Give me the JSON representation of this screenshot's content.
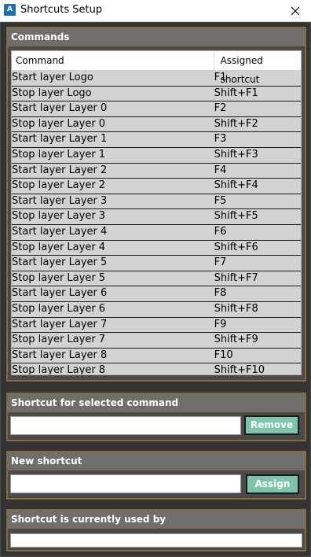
{
  "window": {
    "title": "Shortcuts Setup",
    "app_icon_text": "A"
  },
  "commands": {
    "header": "Commands",
    "columns": [
      "Command",
      "Assigned shortcut"
    ],
    "rows": [
      [
        "Start layer Logo",
        "F1"
      ],
      [
        "Stop layer Logo",
        "Shift+F1"
      ],
      [
        "Start layer Layer 0",
        "F2"
      ],
      [
        "Stop layer Layer 0",
        "Shift+F2"
      ],
      [
        "Start layer Layer 1",
        "F3"
      ],
      [
        "Stop layer Layer 1",
        "Shift+F3"
      ],
      [
        "Start layer Layer 2",
        "F4"
      ],
      [
        "Stop layer Layer 2",
        "Shift+F4"
      ],
      [
        "Start layer Layer 3",
        "F5"
      ],
      [
        "Stop layer Layer 3",
        "Shift+F5"
      ],
      [
        "Start layer Layer 4",
        "F6"
      ],
      [
        "Stop layer Layer 4",
        "Shift+F6"
      ],
      [
        "Start layer Layer 5",
        "F7"
      ],
      [
        "Stop layer Layer 5",
        "Shift+F7"
      ],
      [
        "Start layer Layer 6",
        "F8"
      ],
      [
        "Stop layer Layer 6",
        "Shift+F8"
      ],
      [
        "Start layer Layer 7",
        "F9"
      ],
      [
        "Stop layer Layer 7",
        "Shift+F9"
      ],
      [
        "Start layer Layer 8",
        "F10"
      ],
      [
        "Stop layer Layer 8",
        "Shift+F10"
      ]
    ]
  },
  "selected_shortcut": {
    "header": "Shortcut for selected command",
    "value": "",
    "button_label": "Remove"
  },
  "new_shortcut": {
    "header": "New shortcut",
    "value": "",
    "button_label": "Assign"
  },
  "used_by": {
    "header": "Shortcut is currently used by",
    "value": ""
  },
  "colors": {
    "background": "#333333",
    "panel_header": "#6e6e6e",
    "panel_border": "#8a6a3c",
    "row_background": "#d2d2d2",
    "button_accent": "#7cc4ad"
  }
}
